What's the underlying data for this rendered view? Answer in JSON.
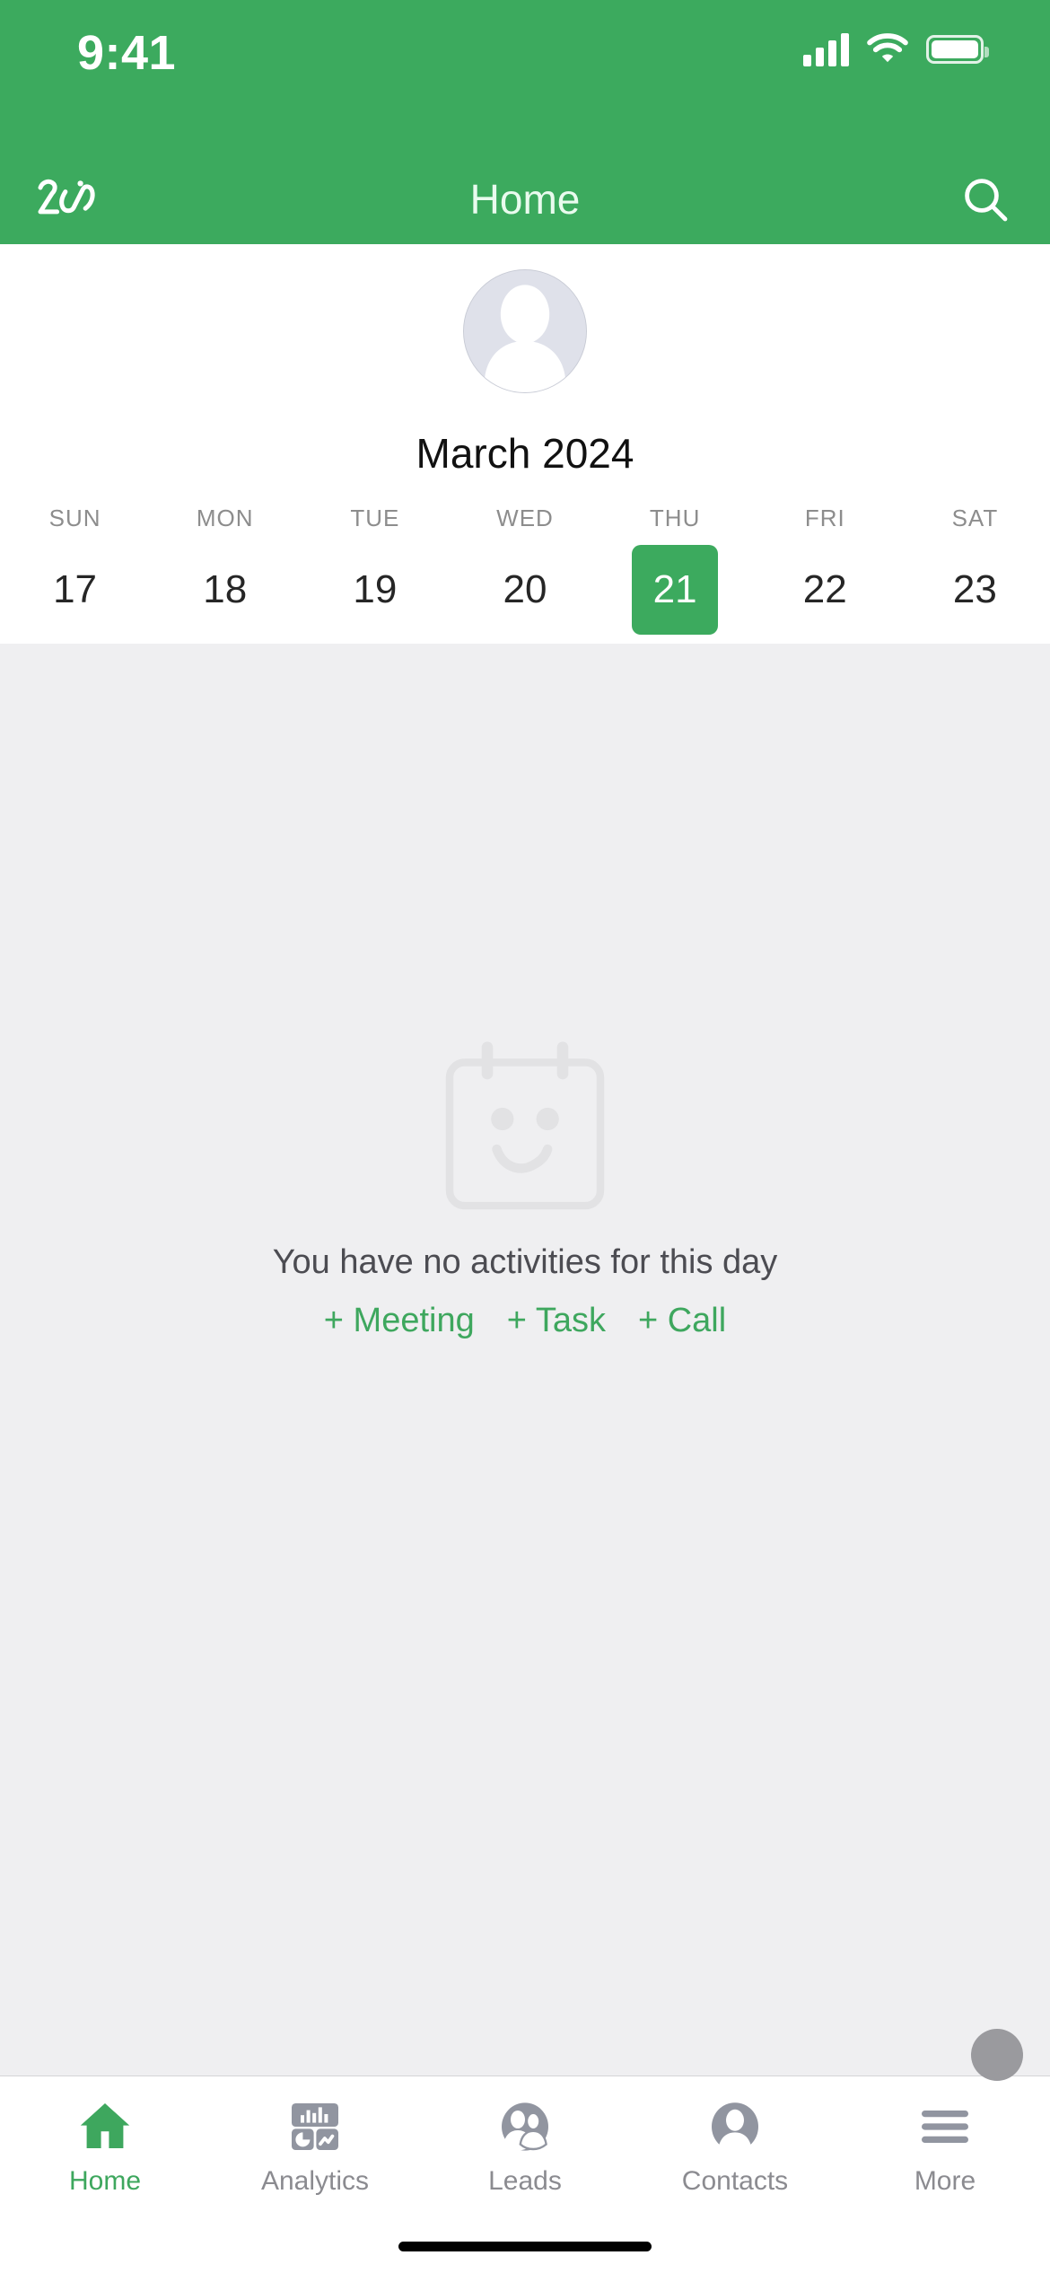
{
  "status_bar": {
    "time": "9:41",
    "signal_icon": "cellular-signal-icon",
    "wifi_icon": "wifi-icon",
    "battery_icon": "battery-icon"
  },
  "nav_bar": {
    "logo_icon": "zia-logo-icon",
    "title": "Home",
    "search_icon": "search-icon"
  },
  "calendar": {
    "avatar_icon": "user-avatar-placeholder",
    "month_label": "March 2024",
    "weekdays": [
      "SUN",
      "MON",
      "TUE",
      "WED",
      "THU",
      "FRI",
      "SAT"
    ],
    "dates": [
      {
        "day": "17",
        "selected": false
      },
      {
        "day": "18",
        "selected": false
      },
      {
        "day": "19",
        "selected": false
      },
      {
        "day": "20",
        "selected": false
      },
      {
        "day": "21",
        "selected": true
      },
      {
        "day": "22",
        "selected": false
      },
      {
        "day": "23",
        "selected": false
      }
    ],
    "selected_date": "21"
  },
  "empty_state": {
    "icon": "calendar-smiley-icon",
    "message": "You have no activities for this day",
    "quick_actions": [
      {
        "label": "+ Meeting",
        "name": "add-meeting-link"
      },
      {
        "label": "+ Task",
        "name": "add-task-link"
      },
      {
        "label": "+ Call",
        "name": "add-call-link"
      }
    ],
    "fab_icon": "floating-action-button"
  },
  "tab_bar": {
    "items": [
      {
        "label": "Home",
        "icon": "home-icon",
        "active": true
      },
      {
        "label": "Analytics",
        "icon": "analytics-icon",
        "active": false
      },
      {
        "label": "Leads",
        "icon": "leads-icon",
        "active": false
      },
      {
        "label": "Contacts",
        "icon": "contacts-icon",
        "active": false
      },
      {
        "label": "More",
        "icon": "hamburger-menu-icon",
        "active": false
      }
    ]
  },
  "colors": {
    "brand_green": "#3CAA5E",
    "accent_green": "#3EA75E",
    "content_bg": "#efeff1",
    "inactive_gray": "#8b8b90",
    "text_dark": "#262626"
  }
}
